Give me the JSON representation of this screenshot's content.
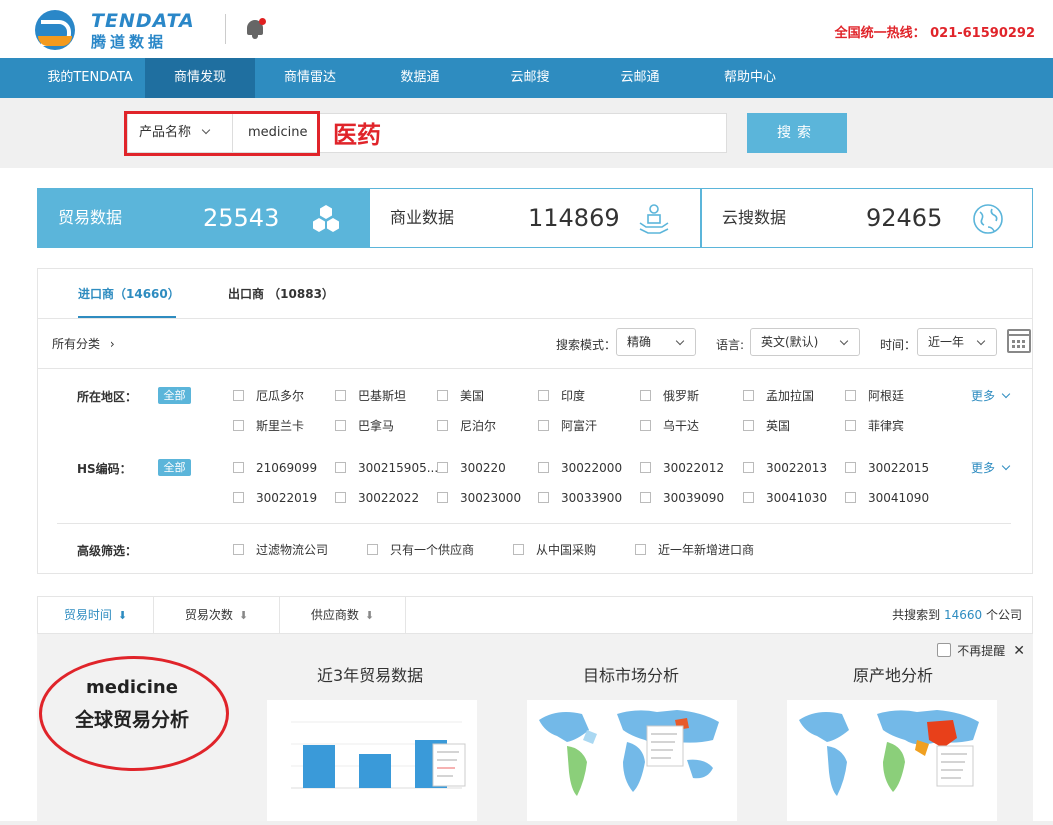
{
  "header": {
    "logo_en": "TENDATA",
    "logo_cn": "腾道数据",
    "hotline": "全国统一热线：  021-61590292"
  },
  "nav": {
    "items": [
      {
        "label": "我的TENDATA"
      },
      {
        "label": "商情发现"
      },
      {
        "label": "商情雷达"
      },
      {
        "label": "数据通"
      },
      {
        "label": "云邮搜"
      },
      {
        "label": "云邮通"
      },
      {
        "label": "帮助中心"
      }
    ]
  },
  "search": {
    "field_select": "产品名称",
    "query": "medicine",
    "annotation": "医药",
    "button": "搜索"
  },
  "stats": [
    {
      "label": "贸易数据",
      "value": "25543",
      "icon": "hexagon-icon"
    },
    {
      "label": "商业数据",
      "value": "114869",
      "icon": "handshake-icon"
    },
    {
      "label": "云搜数据",
      "value": "92465",
      "icon": "globe-icon"
    }
  ],
  "tabs": [
    {
      "label": "进口商（14660）"
    },
    {
      "label": "出口商 （10883）"
    }
  ],
  "filter_bar": {
    "breadcrumb": "所有分类",
    "mode_label": "搜索模式：",
    "mode_value": "精确",
    "lang_label": "语言:",
    "lang_value": "英文(默认)",
    "time_label": "时间：",
    "time_value": "近一年"
  },
  "filters": {
    "region_label": "所在地区：",
    "hs_label": "HS编码：",
    "advanced_label": "高级筛选：",
    "all_badge": "全部",
    "more": "更多",
    "regions": [
      "厄瓜多尔",
      "巴基斯坦",
      "美国",
      "印度",
      "俄罗斯",
      "孟加拉国",
      "阿根廷",
      "斯里兰卡",
      "巴拿马",
      "尼泊尔",
      "阿富汗",
      "乌干达",
      "英国",
      "菲律宾"
    ],
    "hs_codes": [
      "21069099",
      "300215905...",
      "300220",
      "30022000",
      "30022012",
      "30022013",
      "30022015",
      "30022019",
      "30022022",
      "30023000",
      "30033900",
      "30039090",
      "30041030",
      "30041090"
    ],
    "advanced": [
      "过滤物流公司",
      "只有一个供应商",
      "从中国采购",
      "近一年新增进口商"
    ]
  },
  "sortbar": {
    "sorts": [
      {
        "label": "贸易时间"
      },
      {
        "label": "贸易次数"
      },
      {
        "label": "供应商数"
      }
    ],
    "count_prefix": "共搜索到",
    "count": "14660",
    "count_suffix": "个公司"
  },
  "analysis": {
    "no_remind": "不再提醒",
    "keyword": "medicine",
    "subtitle": "全球贸易分析",
    "titles": [
      "近3年贸易数据",
      "目标市场分析",
      "原产地分析"
    ]
  },
  "colors": {
    "nav_bg": "#2e8cc0",
    "accent": "#5bb5da",
    "hotline": "#e0242a"
  }
}
